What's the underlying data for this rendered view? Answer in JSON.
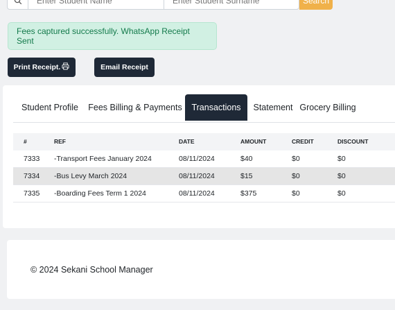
{
  "search": {
    "name_placeholder": "Enter Student Name",
    "surname_placeholder": "Enter Student Surname",
    "button_label": "Search"
  },
  "alert": {
    "message": "Fees captured successfully. WhatsApp Receipt Sent"
  },
  "actions": {
    "print_label": "Print Receipt.",
    "email_label": "Email Receipt"
  },
  "tabs": [
    {
      "label": "Student Profile",
      "active": false
    },
    {
      "label": "Fees Billing & Payments",
      "active": false
    },
    {
      "label": "Transactions",
      "active": true
    },
    {
      "label": "Statement",
      "active": false
    },
    {
      "label": "Grocery Billing",
      "active": false
    }
  ],
  "transactions": {
    "columns": [
      "#",
      "REF",
      "DATE",
      "AMOUNT",
      "CREDIT",
      "DISCOUNT"
    ],
    "rows": [
      {
        "num": "7333",
        "ref": "-Transport Fees January 2024",
        "date": "08/11/2024",
        "amount": "$40",
        "credit": "$0",
        "discount": "$0"
      },
      {
        "num": "7334",
        "ref": "-Bus Levy March 2024",
        "date": "08/11/2024",
        "amount": "$15",
        "credit": "$0",
        "discount": "$0"
      },
      {
        "num": "7335",
        "ref": "-Boarding Fees Term 1 2024",
        "date": "08/11/2024",
        "amount": "$375",
        "credit": "$0",
        "discount": "$0"
      }
    ]
  },
  "footer": {
    "text": "© 2024 Sekani School Manager"
  },
  "colors": {
    "primary_dark": "#1f2937",
    "search_accent": "#f0b14a",
    "success_bg": "#d1f0e3",
    "success_text": "#137a4b"
  }
}
